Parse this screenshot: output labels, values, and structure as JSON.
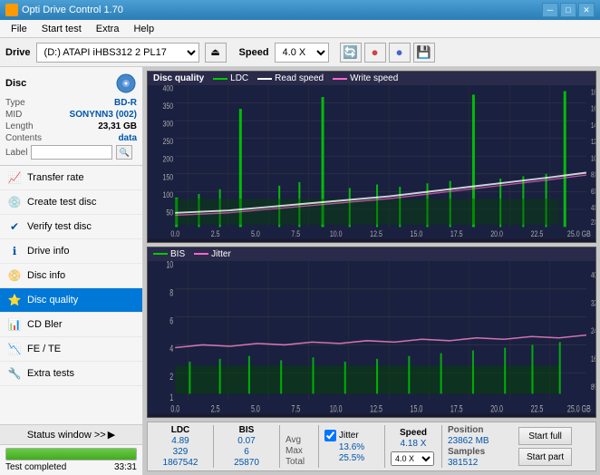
{
  "app": {
    "title": "Opti Drive Control 1.70",
    "icon": "disc-icon"
  },
  "titlebar": {
    "minimize": "─",
    "maximize": "□",
    "close": "✕"
  },
  "menubar": {
    "items": [
      "File",
      "Start test",
      "Extra",
      "Help"
    ]
  },
  "drivebar": {
    "drive_label": "Drive",
    "drive_value": "(D:) ATAPI iHBS312  2 PL17",
    "speed_label": "Speed",
    "speed_value": "4.0 X"
  },
  "disc": {
    "header": "Disc",
    "type_label": "Type",
    "type_value": "BD-R",
    "mid_label": "MID",
    "mid_value": "SONYNN3 (002)",
    "length_label": "Length",
    "length_value": "23,31 GB",
    "contents_label": "Contents",
    "contents_value": "data",
    "label_label": "Label",
    "label_value": ""
  },
  "nav": {
    "items": [
      {
        "id": "transfer-rate",
        "label": "Transfer rate",
        "icon": "📈"
      },
      {
        "id": "create-test-disc",
        "label": "Create test disc",
        "icon": "💿"
      },
      {
        "id": "verify-test-disc",
        "label": "Verify test disc",
        "icon": "✔"
      },
      {
        "id": "drive-info",
        "label": "Drive info",
        "icon": "ℹ"
      },
      {
        "id": "disc-info",
        "label": "Disc info",
        "icon": "📀"
      },
      {
        "id": "disc-quality",
        "label": "Disc quality",
        "icon": "⭐",
        "active": true
      },
      {
        "id": "cd-bler",
        "label": "CD Bler",
        "icon": "📊"
      },
      {
        "id": "fe-te",
        "label": "FE / TE",
        "icon": "📉"
      },
      {
        "id": "extra-tests",
        "label": "Extra tests",
        "icon": "🔧"
      }
    ]
  },
  "status": {
    "window_btn": "Status window >>",
    "progress": 100,
    "status_text": "Test completed",
    "time": "33:31"
  },
  "chart_top": {
    "title": "Disc quality",
    "legend": [
      {
        "label": "LDC",
        "color": "#00cc00"
      },
      {
        "label": "Read speed",
        "color": "#ffffff"
      },
      {
        "label": "Write speed",
        "color": "#ff66cc"
      }
    ],
    "y_max": 400,
    "y_labels_right": [
      "18X",
      "16X",
      "14X",
      "12X",
      "10X",
      "8X",
      "6X",
      "4X",
      "2X"
    ],
    "x_labels": [
      "0.0",
      "2.5",
      "5.0",
      "7.5",
      "10.0",
      "12.5",
      "15.0",
      "17.5",
      "20.0",
      "22.5",
      "25.0 GB"
    ]
  },
  "chart_bottom": {
    "legend": [
      {
        "label": "BIS",
        "color": "#00cc00"
      },
      {
        "label": "Jitter",
        "color": "#ff66cc"
      }
    ],
    "y_max": 10,
    "y_labels_right": [
      "40%",
      "32%",
      "24%",
      "16%",
      "8%"
    ],
    "x_labels": [
      "0.0",
      "2.5",
      "5.0",
      "7.5",
      "10.0",
      "12.5",
      "15.0",
      "17.5",
      "20.0",
      "22.5",
      "25.0 GB"
    ]
  },
  "stats": {
    "col_headers": [
      "LDC",
      "BIS",
      "",
      "Jitter",
      "Speed",
      ""
    ],
    "avg_label": "Avg",
    "max_label": "Max",
    "total_label": "Total",
    "ldc_avg": "4.89",
    "ldc_max": "329",
    "ldc_total": "1867542",
    "bis_avg": "0.07",
    "bis_max": "6",
    "bis_total": "25870",
    "jitter_avg": "13.6%",
    "jitter_max": "25.5%",
    "jitter_total": "",
    "speed_avg": "4.18 X",
    "speed_select": "4.0 X",
    "position_label": "Position",
    "position_val": "23862 MB",
    "samples_label": "Samples",
    "samples_val": "381512",
    "start_full_btn": "Start full",
    "start_part_btn": "Start part"
  }
}
